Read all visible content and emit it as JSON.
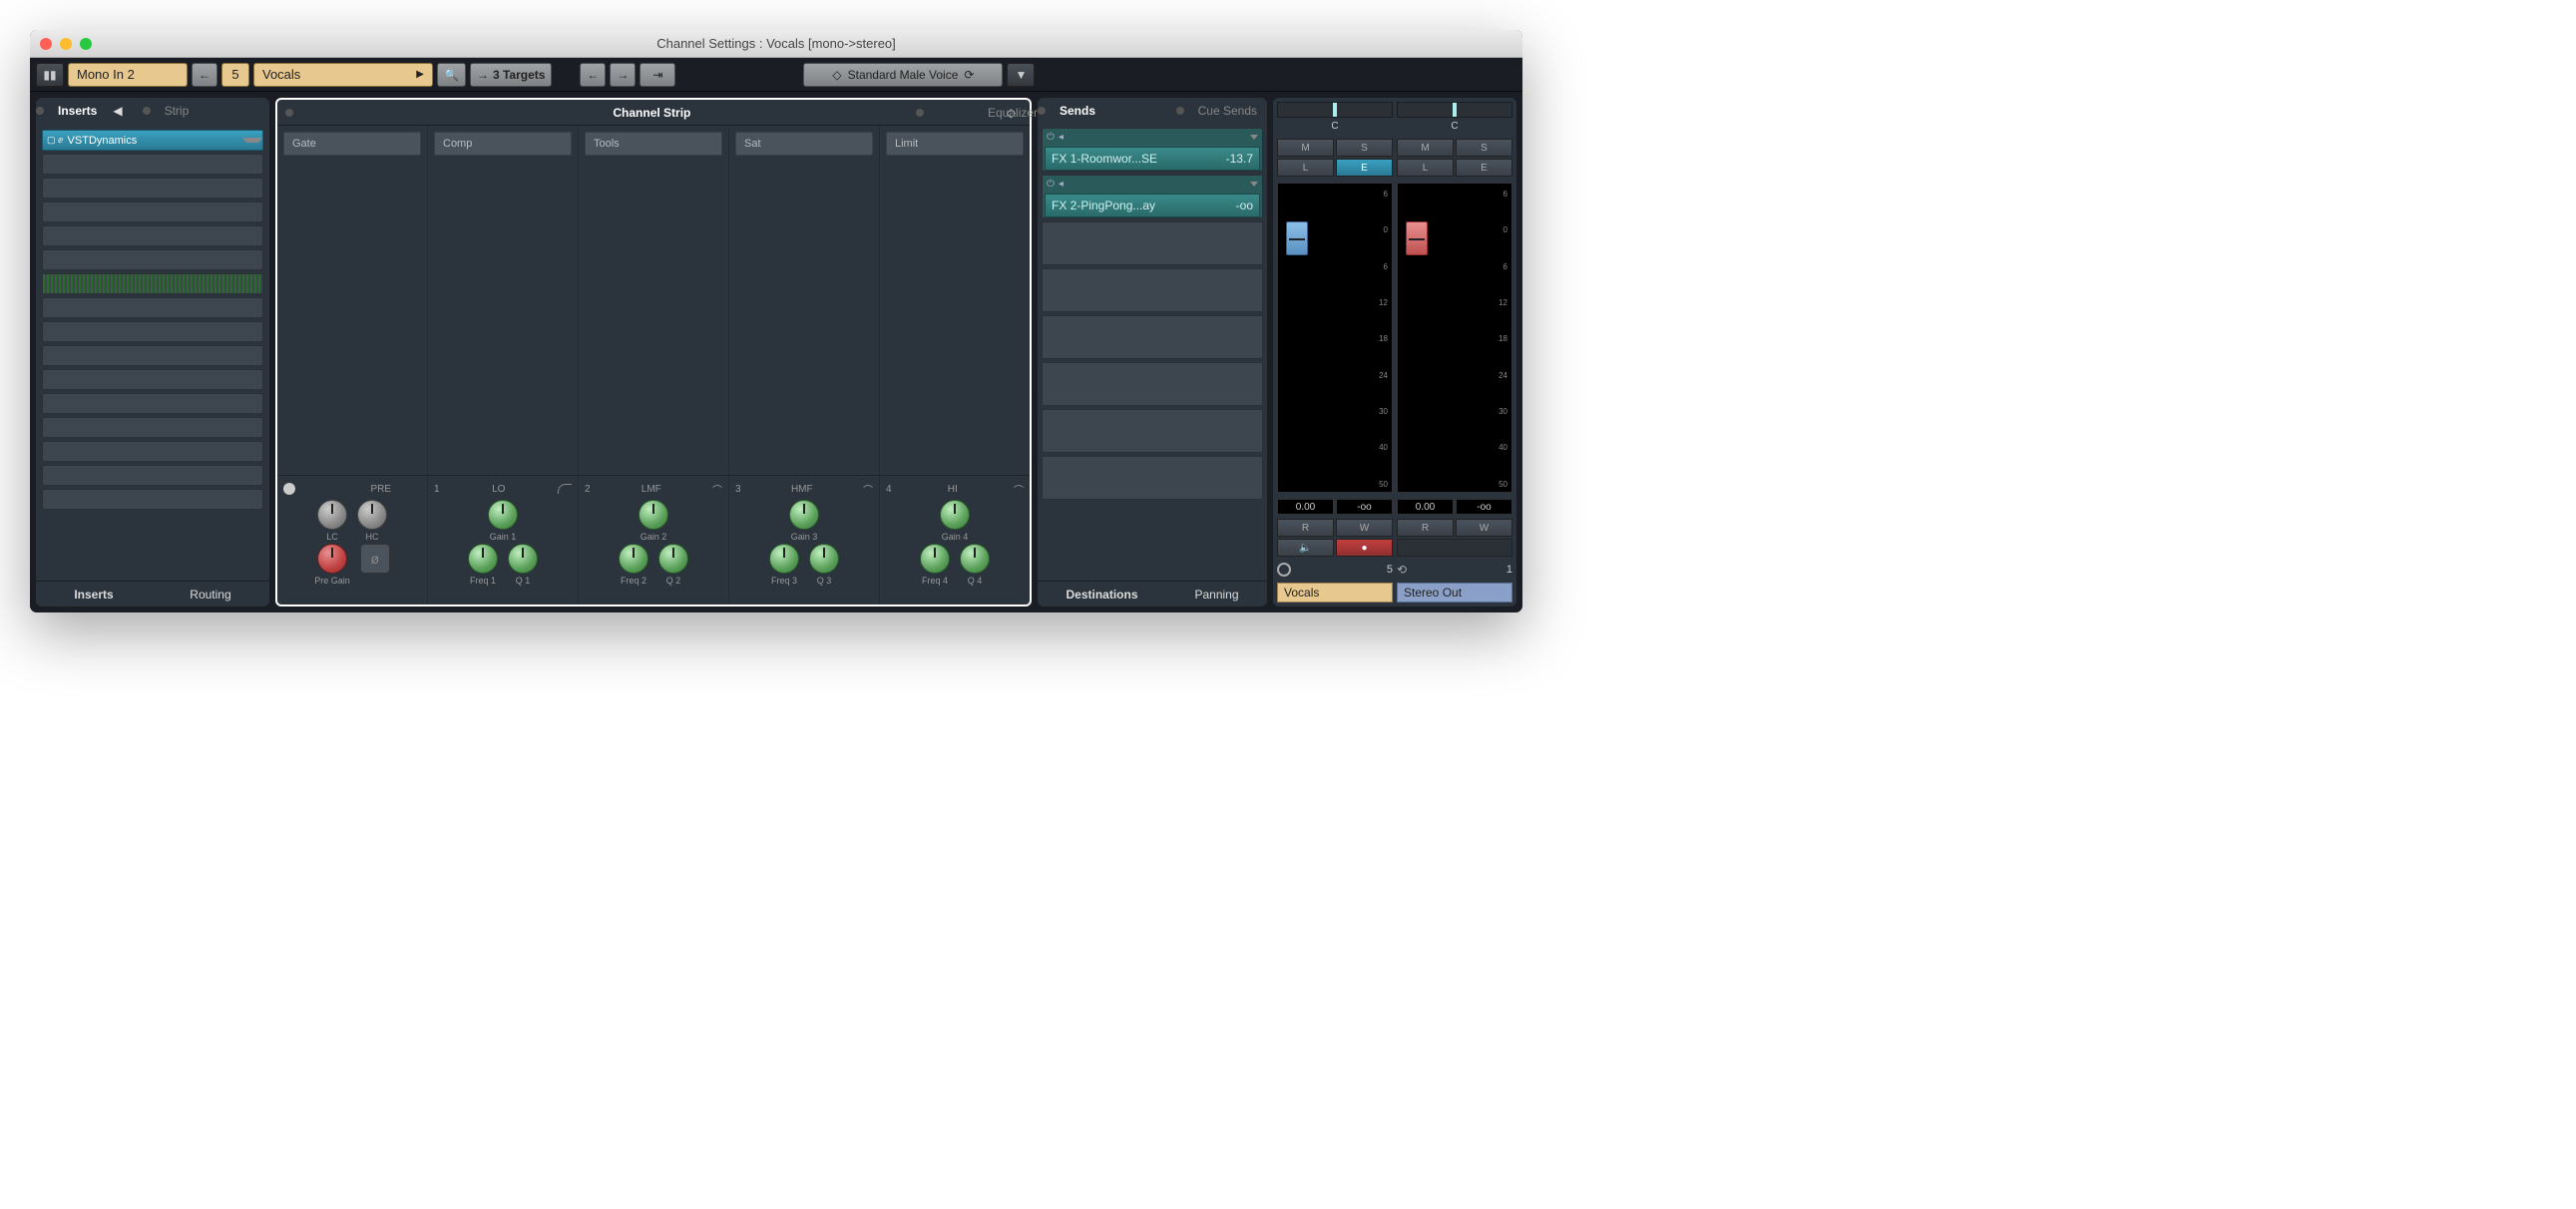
{
  "window": {
    "title": "Channel Settings : Vocals [mono->stereo]"
  },
  "toolbar": {
    "input": "Mono In 2",
    "chain_count": "5",
    "channel_name": "Vocals",
    "targets": "3 Targets",
    "preset": "Standard Male Voice"
  },
  "inserts": {
    "tab_inserts": "Inserts",
    "tab_strip": "Strip",
    "plugin1": "VSTDynamics",
    "bottom_inserts": "Inserts",
    "bottom_routing": "Routing"
  },
  "center": {
    "tab_strip": "Channel Strip",
    "tab_eq": "Equalizer",
    "cols": [
      "Gate",
      "Comp",
      "Tools",
      "Sat",
      "Limit"
    ],
    "pre": {
      "label": "PRE",
      "lc": "LC",
      "hc": "HC",
      "pregain": "Pre Gain"
    },
    "bands": [
      {
        "num": "1",
        "name": "LO",
        "gain": "Gain 1",
        "freq": "Freq 1",
        "q": "Q 1"
      },
      {
        "num": "2",
        "name": "LMF",
        "gain": "Gain 2",
        "freq": "Freq 2",
        "q": "Q 2"
      },
      {
        "num": "3",
        "name": "HMF",
        "gain": "Gain 3",
        "freq": "Freq 3",
        "q": "Q 3"
      },
      {
        "num": "4",
        "name": "HI",
        "gain": "Gain 4",
        "freq": "Freq 4",
        "q": "Q 4"
      }
    ]
  },
  "sends": {
    "tab_sends": "Sends",
    "tab_cue": "Cue Sends",
    "s1_name": "FX 1-Roomwor...SE",
    "s1_val": "-13.7",
    "s2_name": "FX 2-PingPong...ay",
    "s2_val": "-oo",
    "bottom_dest": "Destinations",
    "bottom_pan": "Panning"
  },
  "faders": {
    "pan_c": "C",
    "btn_m": "M",
    "btn_s": "S",
    "btn_l": "L",
    "btn_e": "E",
    "btn_r": "R",
    "btn_w": "W",
    "scale": [
      "6",
      "0",
      "6",
      "12",
      "18",
      "24",
      "30",
      "40",
      "50"
    ],
    "level_l": "0.00",
    "peak_l": "-oo",
    "level_r": "0.00",
    "peak_r": "-oo",
    "count_l": "5",
    "count_r": "1",
    "name_l": "Vocals",
    "name_r": "Stereo Out"
  }
}
